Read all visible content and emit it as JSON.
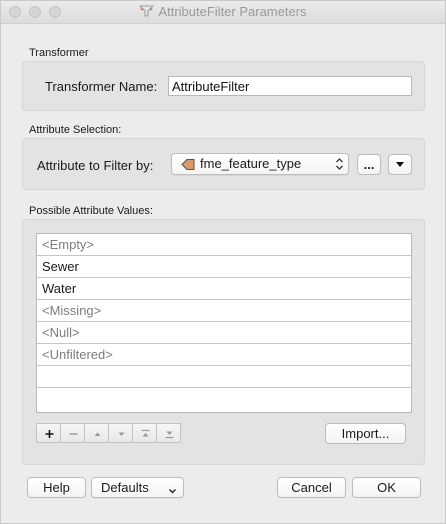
{
  "window": {
    "title": "AttributeFilter Parameters"
  },
  "transformer": {
    "section_label": "Transformer",
    "name_label": "Transformer Name:",
    "name_value": "AttributeFilter"
  },
  "attribute_selection": {
    "section_label": "Attribute Selection:",
    "filter_label": "Attribute to Filter by:",
    "selected_attribute": "fme_feature_type",
    "browse_label": "...",
    "icons": {
      "attribute": "attribute-tag-icon",
      "chevrons": "up-down-chevron-icon",
      "dropdown": "triangle-down-icon"
    }
  },
  "possible_values": {
    "section_label": "Possible Attribute Values:",
    "rows": [
      {
        "text": "<Empty>",
        "placeholder": true
      },
      {
        "text": "Sewer",
        "placeholder": false
      },
      {
        "text": "Water",
        "placeholder": false
      },
      {
        "text": "<Missing>",
        "placeholder": true
      },
      {
        "text": "<Null>",
        "placeholder": true
      },
      {
        "text": "<Unfiltered>",
        "placeholder": true
      },
      {
        "text": "",
        "placeholder": false
      }
    ],
    "tools": [
      "plus-icon",
      "minus-icon",
      "move-up-icon",
      "move-down-icon",
      "move-to-top-icon",
      "move-to-bottom-icon"
    ],
    "import_label": "Import..."
  },
  "footer": {
    "help_label": "Help",
    "defaults_label": "Defaults",
    "cancel_label": "Cancel",
    "ok_label": "OK"
  }
}
